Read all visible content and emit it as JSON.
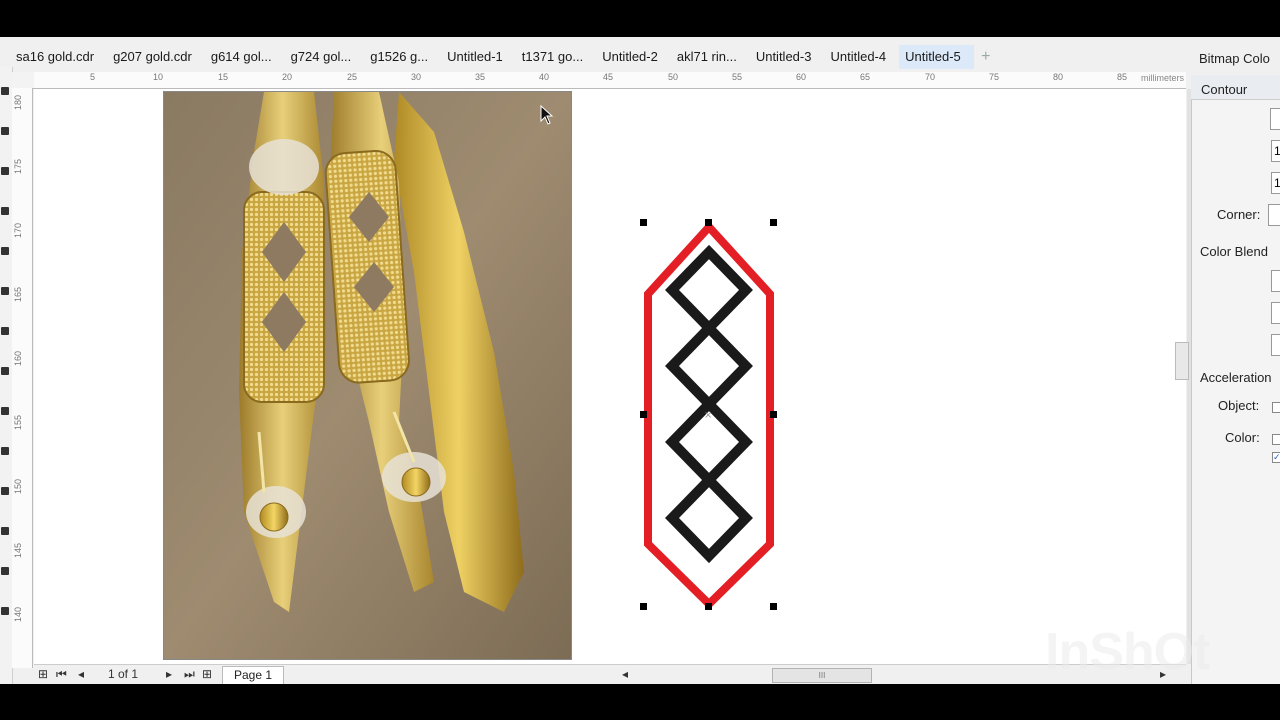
{
  "document_tabs": [
    {
      "label": "sa16 gold.cdr",
      "active": false
    },
    {
      "label": "g207 gold.cdr",
      "active": false
    },
    {
      "label": "g614 gol...",
      "active": false
    },
    {
      "label": "g724 gol...",
      "active": false
    },
    {
      "label": "g1526 g...",
      "active": false
    },
    {
      "label": "Untitled-1",
      "active": false
    },
    {
      "label": "t1371 go...",
      "active": false
    },
    {
      "label": "Untitled-2",
      "active": false
    },
    {
      "label": "akl71 rin...",
      "active": false
    },
    {
      "label": "Untitled-3",
      "active": false
    },
    {
      "label": "Untitled-4",
      "active": false
    },
    {
      "label": "Untitled-5",
      "active": true
    }
  ],
  "add_tab_symbol": "+",
  "docker": {
    "tab_label": "Bitmap Colo",
    "title": "Contour",
    "corner_label": "Corner:",
    "color_blend_label": "Color Blend",
    "acceleration_label": "Acceleration",
    "object_label": "Object:",
    "color_label": "Color:",
    "value_1": "1",
    "value_2": "1",
    "checkbox_mark": "✓"
  },
  "ruler": {
    "unit": "millimeters",
    "h_ticks": [
      "5",
      "10",
      "15",
      "20",
      "25",
      "30",
      "35",
      "40",
      "45",
      "50",
      "55",
      "60",
      "65",
      "70",
      "75",
      "80",
      "85"
    ],
    "v_ticks": [
      "180",
      "175",
      "170",
      "165",
      "160",
      "155",
      "150",
      "145",
      "140"
    ],
    "v_unit": "millimeters"
  },
  "status": {
    "page_count": "1 of 1",
    "page_tab": "Page 1",
    "scroll_grip": "III"
  },
  "colors": {
    "contour_red": "#e31e24",
    "diamond_black": "#1a1a1a",
    "gold": "#c9a642",
    "active_tab": "#dbe9f8"
  },
  "watermark": "InShOt"
}
